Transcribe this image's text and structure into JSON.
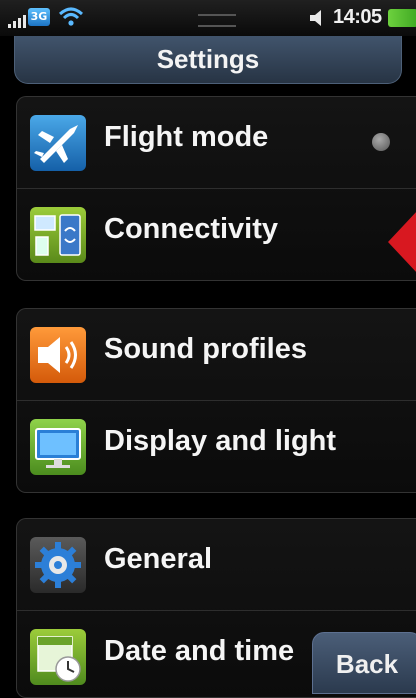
{
  "status": {
    "network": "3G",
    "time": "14:05"
  },
  "header": {
    "title": "Settings"
  },
  "groups": [
    {
      "items": [
        {
          "label": "Flight mode",
          "icon": "airplane-icon"
        },
        {
          "label": "Connectivity",
          "icon": "connectivity-icon"
        }
      ]
    },
    {
      "items": [
        {
          "label": "Sound profiles",
          "icon": "speaker-icon"
        },
        {
          "label": "Display and light",
          "icon": "monitor-icon"
        }
      ]
    },
    {
      "items": [
        {
          "label": "General",
          "icon": "gear-icon"
        },
        {
          "label": "Date and time",
          "icon": "calendar-clock-icon"
        }
      ]
    }
  ],
  "footer": {
    "back_label": "Back"
  },
  "colors": {
    "title_bar": "#344458",
    "highlight_arrow": "#d81820",
    "battery": "#5cc635"
  }
}
